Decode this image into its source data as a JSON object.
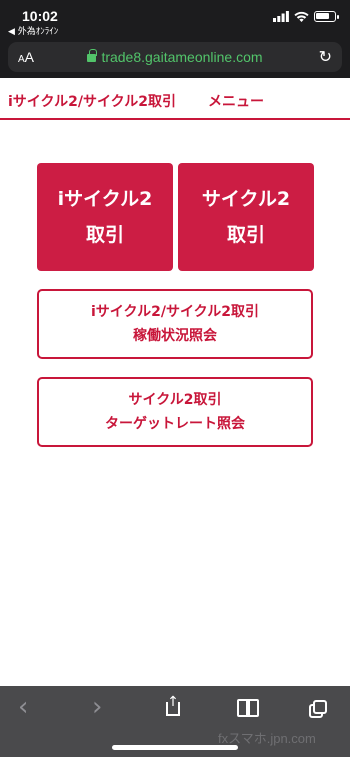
{
  "status": {
    "time": "10:02",
    "back_app": "◀ 外為ｵﾝﾗｲﾝ"
  },
  "browser": {
    "text_size_label": "AA",
    "url": "trade8.gaitameonline.com",
    "reload_glyph": "↻"
  },
  "nav": {
    "cycle_label": "iサイクル2/サイクル2取引",
    "menu_label": "メニュー"
  },
  "tiles": {
    "icycle": {
      "line1": "iサイクル2",
      "line2": "取引"
    },
    "cycle": {
      "line1": "サイクル2",
      "line2": "取引"
    }
  },
  "buttons": {
    "status": {
      "line1": "iサイクル2/サイクル2取引",
      "line2": "稼働状況照会"
    },
    "target": {
      "line1": "サイクル2取引",
      "line2": "ターゲットレート照会"
    }
  },
  "toolbar": {
    "back_glyph": "‹",
    "forward_glyph": "›"
  },
  "watermark": "fxスマホ.jpn.com",
  "colors": {
    "accent": "#c8163a",
    "tile_bg": "#cc1d44",
    "url_green": "#52c46a"
  },
  "icons": [
    "wifi-icon",
    "signal-icon",
    "battery-icon",
    "lock-icon",
    "reload-icon",
    "back-icon",
    "forward-icon",
    "share-icon",
    "bookmarks-icon",
    "tabs-icon"
  ]
}
